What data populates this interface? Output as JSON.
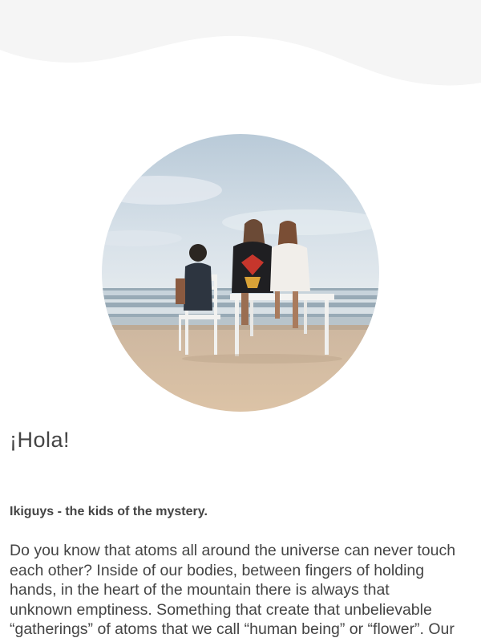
{
  "page": {
    "greeting": "¡Hola!",
    "subtitle": "Ikiguys - the kids of the mystery.",
    "body_lines": [
      "Do you know that atoms all around the universe can never touch",
      "each other? Inside of our bodies, between fingers of holding",
      "hands, in the heart of the mountain there is always that",
      "unknown emptiness. Something that create that unbelievable",
      "“gatherings” of atoms that we call “human being” or “flower”. Our"
    ]
  },
  "colors": {
    "wave": "#f5f5f5",
    "text": "#444444",
    "sky": "#cfdce6",
    "sea": "#9fb2bf",
    "sand": "#d8bfa2"
  },
  "icons": {
    "hero_image": "beach-photo-three-people-sitting-on-white-bench-and-chair"
  }
}
